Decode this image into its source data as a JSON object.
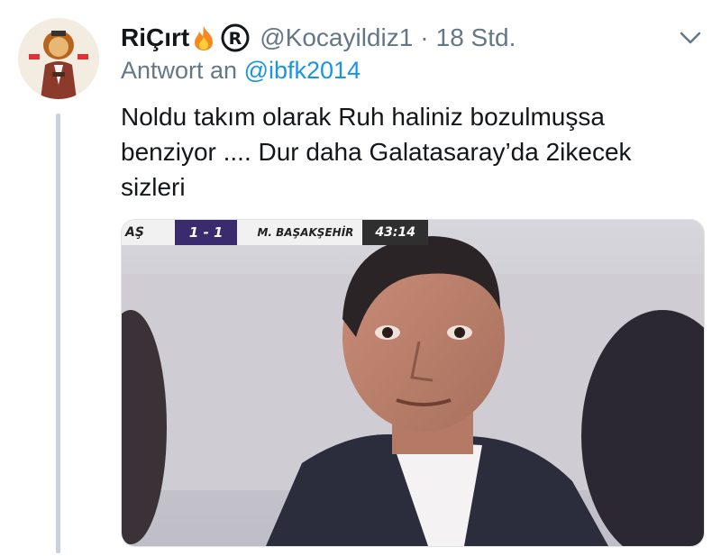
{
  "tweet": {
    "display_name": "RiÇırt",
    "handle": "@Kocayildiz1",
    "separator": "·",
    "time": "18 Std.",
    "reply_prefix": "Antwort an",
    "reply_to": "@ibfk2014",
    "text": "Noldu takım olarak Ruh haliniz bozulmuşsa benziyor .... Dur daha Galatasaray’da 2ikecek sizleri"
  },
  "media": {
    "scoreboard": {
      "team1": "AŞ",
      "score": "1 - 1",
      "team2": "M. BAŞAKŞEHİR",
      "clock": "43:14"
    }
  },
  "colors": {
    "text": "#14171a",
    "secondary": "#657786",
    "link": "#1b95e0",
    "thread_line": "#c6d2dc"
  },
  "icons": [
    "avatar-lion-illustration",
    "flame-icon",
    "registered-icon",
    "chevron-down-icon"
  ]
}
